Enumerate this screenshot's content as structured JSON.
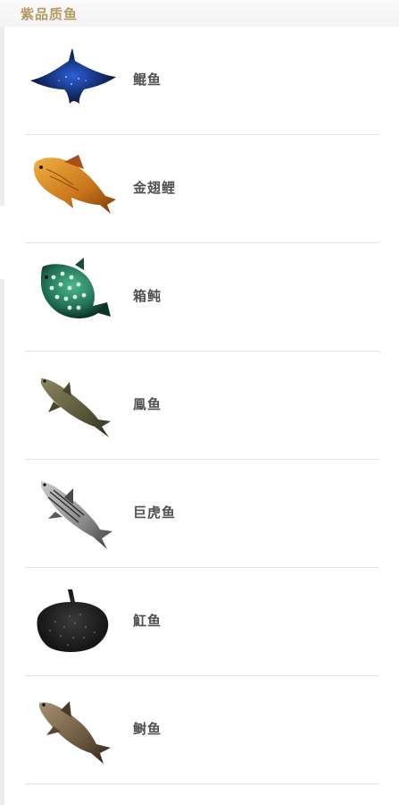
{
  "section": {
    "title": "紫品质鱼"
  },
  "fish": [
    {
      "name": "鲲鱼",
      "icon": "manta-ray-icon"
    },
    {
      "name": "金翅鲤",
      "icon": "golden-carp-icon"
    },
    {
      "name": "箱鲀",
      "icon": "boxfish-icon"
    },
    {
      "name": "鳯鱼",
      "icon": "slender-fish-icon"
    },
    {
      "name": "巨虎鱼",
      "icon": "tigerfish-icon"
    },
    {
      "name": "魟鱼",
      "icon": "stingray-icon"
    },
    {
      "name": "鲥鱼",
      "icon": "shad-icon"
    }
  ]
}
